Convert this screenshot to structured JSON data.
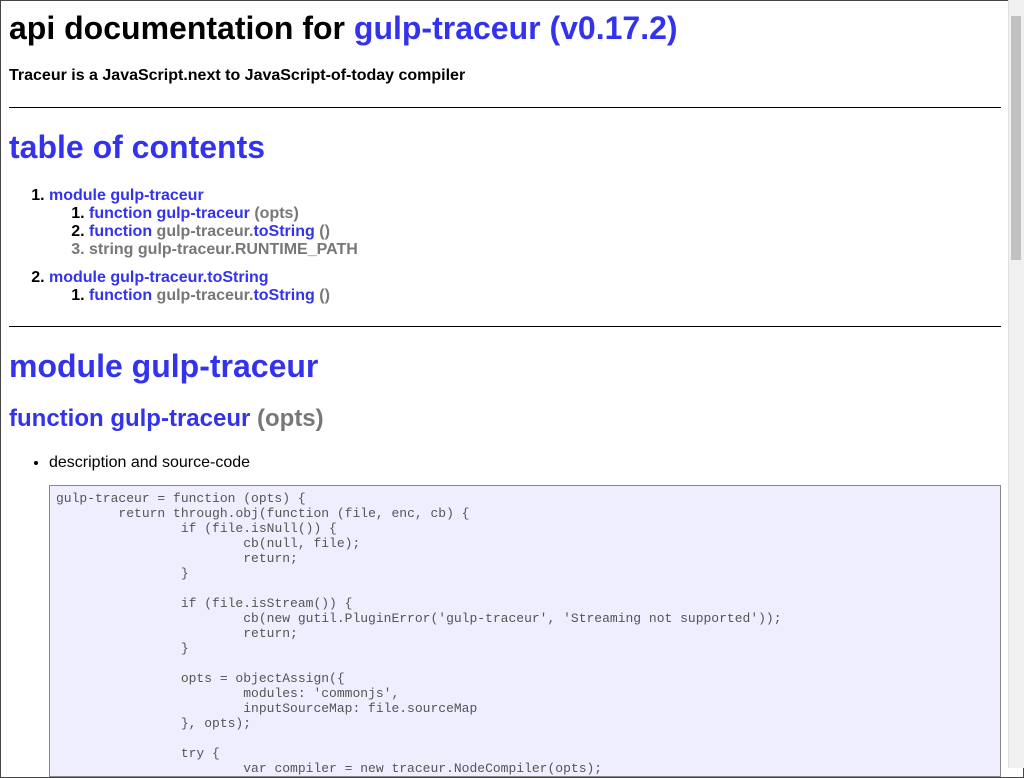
{
  "header": {
    "title_prefix": "api documentation for",
    "title_link": "gulp-traceur (v0.17.2)",
    "description": "Traceur is a JavaScript.next to JavaScript-of-today compiler"
  },
  "toc": {
    "title": "table of contents",
    "modules": [
      {
        "label": "module gulp-traceur",
        "items": [
          {
            "kind": "function",
            "name": "gulp-traceur",
            "name_link": true,
            "args": "(opts)"
          },
          {
            "kind": "function",
            "prefix": "gulp-traceur.",
            "name": "toString",
            "args": "()"
          },
          {
            "kind": "string",
            "text": "gulp-traceur.RUNTIME_PATH"
          }
        ]
      },
      {
        "label": "module gulp-traceur.toString",
        "items": [
          {
            "kind": "function",
            "prefix": "gulp-traceur.",
            "name": "toString",
            "args": "()"
          }
        ]
      }
    ]
  },
  "section": {
    "module_title": "module gulp-traceur",
    "function_kind": "function",
    "function_name": "gulp-traceur",
    "function_args": "(opts)",
    "bullet": "description and source-code",
    "code": "gulp-traceur = function (opts) {\n\treturn through.obj(function (file, enc, cb) {\n\t\tif (file.isNull()) {\n\t\t\tcb(null, file);\n\t\t\treturn;\n\t\t}\n\n\t\tif (file.isStream()) {\n\t\t\tcb(new gutil.PluginError('gulp-traceur', 'Streaming not supported'));\n\t\t\treturn;\n\t\t}\n\n\t\topts = objectAssign({\n\t\t\tmodules: 'commonjs',\n\t\t\tinputSourceMap: file.sourceMap\n\t\t}, opts);\n\n\t\ttry {\n\t\t\tvar compiler = new traceur.NodeCompiler(opts);"
  },
  "colors": {
    "link": "#3333ee",
    "muted": "#777777",
    "code_bg": "#eeeeff"
  }
}
